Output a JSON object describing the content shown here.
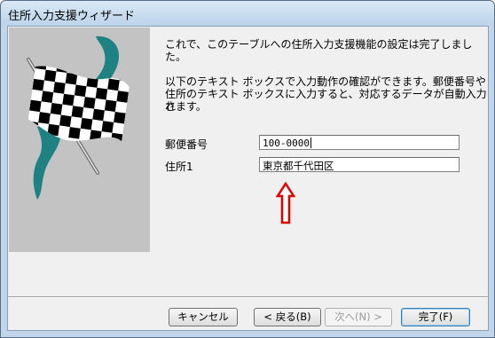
{
  "window": {
    "title": "住所入力支援ウィザード"
  },
  "icons": {
    "wizard_art": "checkered-flag-icon",
    "annotation": "up-arrow-icon"
  },
  "colors": {
    "art_background": "#c3c3c3",
    "swoosh": "#1e8282",
    "annotation_arrow": "#e00000"
  },
  "content": {
    "message1": "これで、このテーブルへの住所入力支援機能の設定は完了しました。",
    "message2_line1": "以下のテキスト ボックスで入力動作の確認ができます。郵便番号や",
    "message2_line2": "住所のテキスト ボックスに入力すると、対応するデータが自動入力さ",
    "message2_line3": "れます。",
    "postal_label": "郵便番号",
    "postal_value": "100-0000",
    "address_label": "住所1",
    "address_value": "東京都千代田区"
  },
  "buttons": {
    "cancel": "キャンセル",
    "back": "< 戻る(B)",
    "next": "次へ(N) >",
    "finish": "完了(F)"
  }
}
